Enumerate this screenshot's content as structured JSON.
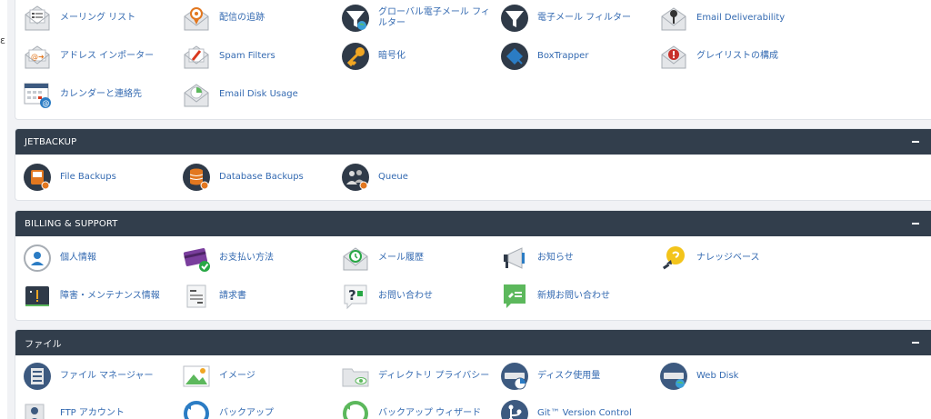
{
  "email_items": [
    {
      "label": "メーリング リスト",
      "icon": "mailing-list-icon"
    },
    {
      "label": "配信の追跡",
      "icon": "track-delivery-icon"
    },
    {
      "label": "グローバル電子メール フィルター",
      "icon": "global-email-filter-icon"
    },
    {
      "label": "電子メール フィルター",
      "icon": "email-filter-icon"
    },
    {
      "label": "Email Deliverability",
      "icon": "email-deliverability-icon"
    },
    {
      "label": "アドレス インポーター",
      "icon": "address-importer-icon"
    },
    {
      "label": "Spam Filters",
      "icon": "spam-filters-icon"
    },
    {
      "label": "暗号化",
      "icon": "encryption-key-icon"
    },
    {
      "label": "BoxTrapper",
      "icon": "boxtrapper-icon"
    },
    {
      "label": "グレイリストの構成",
      "icon": "greylisting-icon"
    },
    {
      "label": "カレンダーと連絡先",
      "icon": "calendar-contacts-icon"
    },
    {
      "label": "Email Disk Usage",
      "icon": "email-disk-usage-icon"
    }
  ],
  "jetbackup": {
    "title": "JETBACKUP",
    "items": [
      {
        "label": "File Backups",
        "icon": "file-backups-icon"
      },
      {
        "label": "Database Backups",
        "icon": "database-backups-icon"
      },
      {
        "label": "Queue",
        "icon": "queue-icon"
      }
    ]
  },
  "billing": {
    "title": "BILLING & SUPPORT",
    "items": [
      {
        "label": "個人情報",
        "icon": "personal-info-icon"
      },
      {
        "label": "お支払い方法",
        "icon": "payment-method-icon"
      },
      {
        "label": "メール履歴",
        "icon": "email-history-icon"
      },
      {
        "label": "お知らせ",
        "icon": "announcements-megaphone-icon"
      },
      {
        "label": "ナレッジベース",
        "icon": "knowledge-base-bulb-icon"
      },
      {
        "label": "障害・メンテナンス情報",
        "icon": "server-status-icon"
      },
      {
        "label": "請求書",
        "icon": "invoices-icon"
      },
      {
        "label": "お問い合わせ",
        "icon": "contact-question-icon"
      },
      {
        "label": "新規お問い合わせ",
        "icon": "new-ticket-icon"
      }
    ]
  },
  "files": {
    "title": "ファイル",
    "items": [
      {
        "label": "ファイル マネージャー",
        "icon": "file-manager-icon"
      },
      {
        "label": "イメージ",
        "icon": "images-icon"
      },
      {
        "label": "ディレクトリ プライバシー",
        "icon": "directory-privacy-icon"
      },
      {
        "label": "ディスク使用量",
        "icon": "disk-usage-icon"
      },
      {
        "label": "Web Disk",
        "icon": "web-disk-icon"
      },
      {
        "label": "FTP アカウント",
        "icon": "ftp-accounts-icon"
      },
      {
        "label": "バックアップ",
        "icon": "backup-icon"
      },
      {
        "label": "バックアップ ウィザード",
        "icon": "backup-wizard-icon"
      },
      {
        "label": "Git™ Version Control",
        "icon": "git-version-control-icon"
      }
    ]
  },
  "colors": {
    "header": "#323e4c",
    "link": "#346ab1",
    "background": "#f1f2f5"
  }
}
